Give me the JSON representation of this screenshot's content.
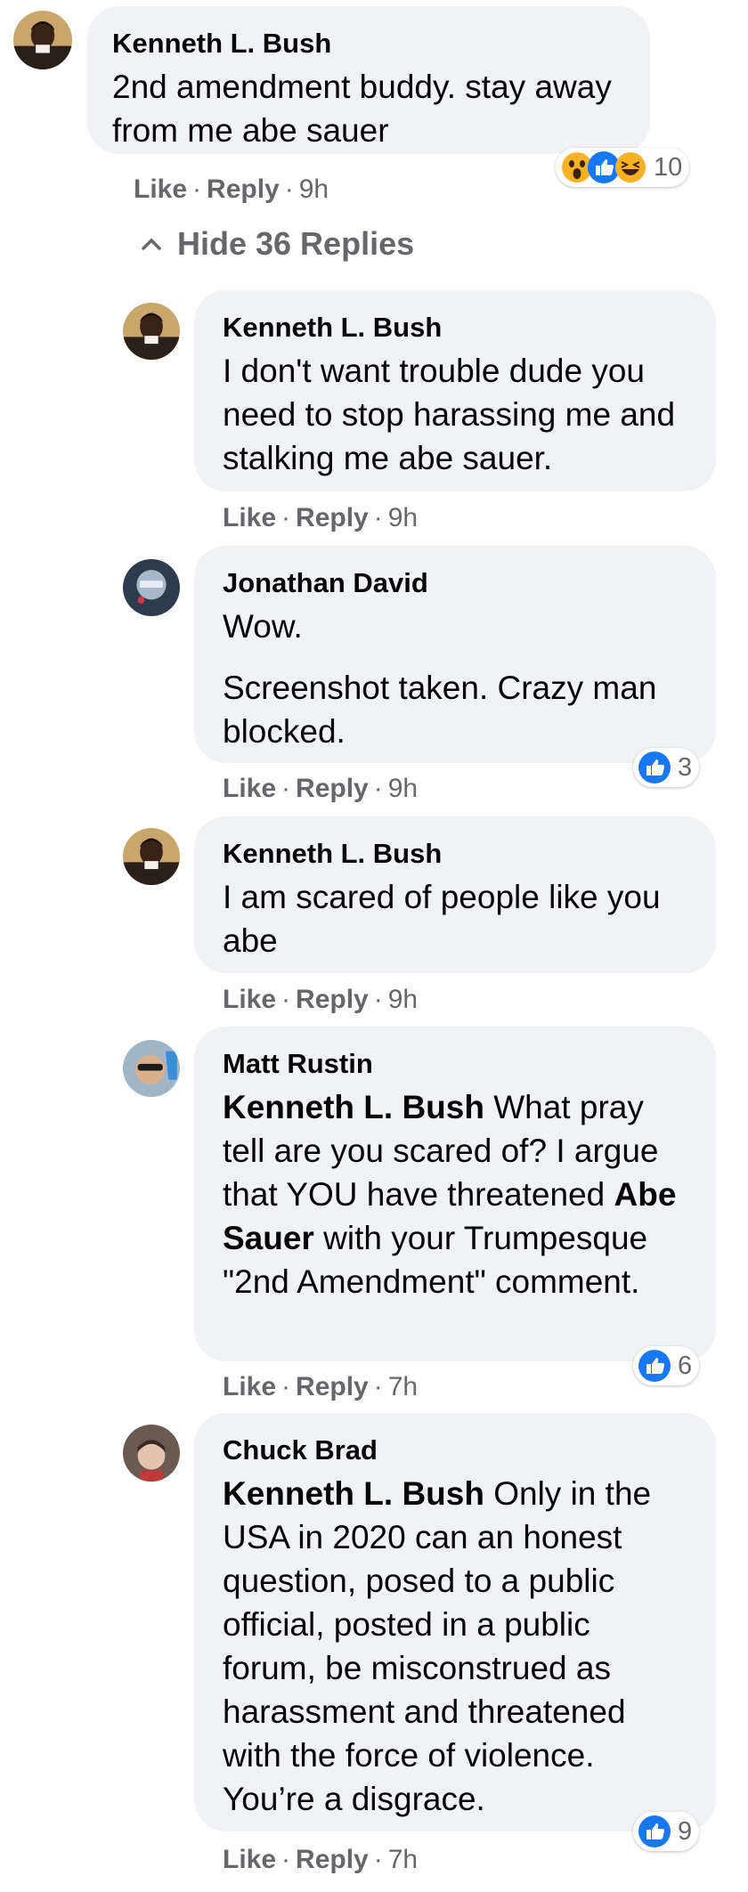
{
  "comments": [
    {
      "author": "Kenneth L. Bush",
      "avatar": "kenneth-avatar",
      "body": "2nd amendment buddy. stay away from me abe sauer",
      "like": "Like",
      "reply": "Reply",
      "time": "9h",
      "reactions": [
        "wow-reaction",
        "like-reaction",
        "haha-reaction"
      ],
      "reaction_count": "10"
    },
    {
      "author": "Kenneth L. Bush",
      "avatar": "kenneth-avatar",
      "body": "I don't want trouble dude you need to stop harassing me and stalking me abe sauer.",
      "like": "Like",
      "reply": "Reply",
      "time": "9h"
    },
    {
      "author": "Jonathan David",
      "avatar": "jonathan-avatar",
      "body_line1": "Wow.",
      "body_line2": "Screenshot taken. Crazy man blocked.",
      "like": "Like",
      "reply": "Reply",
      "time": "9h",
      "reactions": [
        "like-reaction"
      ],
      "reaction_count": "3"
    },
    {
      "author": "Kenneth L. Bush",
      "avatar": "kenneth-avatar",
      "body": "I am scared of people like you abe",
      "like": "Like",
      "reply": "Reply",
      "time": "9h"
    },
    {
      "author": "Matt Rustin",
      "avatar": "matt-avatar",
      "mention1": "Kenneth L. Bush",
      "text1": " What pray tell are you scared of? I argue that YOU have threatened ",
      "mention2": "Abe Sauer",
      "text2": " with your Trumpesque \"2nd Amendment\" comment.",
      "like": "Like",
      "reply": "Reply",
      "time": "7h",
      "reactions": [
        "like-reaction"
      ],
      "reaction_count": "6"
    },
    {
      "author": "Chuck Brad",
      "avatar": "chuck-avatar",
      "mention1": "Kenneth L. Bush",
      "text1": " Only in the USA in 2020 can an honest question, posed to a public official, posted in a public forum, be misconstrued as harassment and threatened with the force of violence. You’re a disgrace.",
      "like": "Like",
      "reply": "Reply",
      "time": "7h",
      "reactions": [
        "like-reaction"
      ],
      "reaction_count": "9"
    }
  ],
  "hide_replies": "Hide 36 Replies",
  "colors": {
    "bubble": "#f0f2f5",
    "meta": "#65676b",
    "like_blue": "#1877f2",
    "text": "#050505"
  }
}
